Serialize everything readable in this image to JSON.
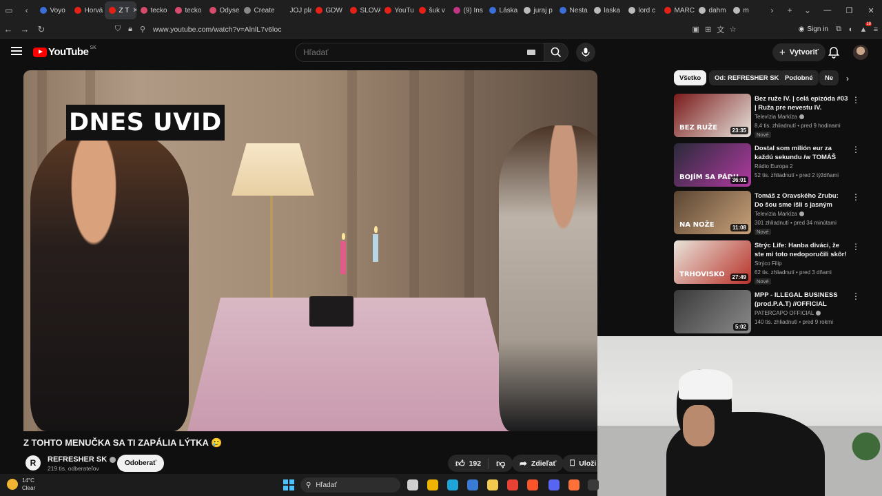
{
  "browser": {
    "tabs": [
      {
        "label": "Voyo",
        "color": "#3b6fd8",
        "active": false
      },
      {
        "label": "Horvá",
        "color": "#e62117",
        "active": false
      },
      {
        "label": "Z T",
        "color": "#e62117",
        "active": true
      },
      {
        "label": "tecko",
        "color": "#d64b6b",
        "active": false
      },
      {
        "label": "tecko",
        "color": "#d64b6b",
        "active": false
      },
      {
        "label": "Odyse",
        "color": "#d64b6b",
        "active": false
      },
      {
        "label": "Create",
        "color": "#888888",
        "active": false
      },
      {
        "label": "JOJ play",
        "color": "#1f1f1f",
        "active": false
      },
      {
        "label": "GDW",
        "color": "#e62117",
        "active": false
      },
      {
        "label": "SLOVA",
        "color": "#e62117",
        "active": false
      },
      {
        "label": "YouTu",
        "color": "#e62117",
        "active": false
      },
      {
        "label": "šuk v",
        "color": "#e62117",
        "active": false
      },
      {
        "label": "(9) Ins",
        "color": "#c13584",
        "active": false
      },
      {
        "label": "Láska",
        "color": "#3b6fd8",
        "active": false
      },
      {
        "label": "juraj p",
        "color": "#bbbbbb",
        "active": false
      },
      {
        "label": "Nesta",
        "color": "#3b6fd8",
        "active": false
      },
      {
        "label": "laska",
        "color": "#bbbbbb",
        "active": false
      },
      {
        "label": "lord c",
        "color": "#bbbbbb",
        "active": false
      },
      {
        "label": "MARC",
        "color": "#e62117",
        "active": false
      },
      {
        "label": "dahm",
        "color": "#bbbbbb",
        "active": false
      },
      {
        "label": "m",
        "color": "#bbbbbb",
        "active": false
      }
    ],
    "url": "www.youtube.com/watch?v=AlnlL7v6loc",
    "signin_label": "Sign in",
    "ext_badge": "18"
  },
  "youtube": {
    "logo_text": "YouTube",
    "country": "SK",
    "search_placeholder": "Hľadať",
    "create_label": "Vytvoriť",
    "chips": [
      "Všetko",
      "Od: REFRESHER SK",
      "Podobné",
      "Ne"
    ]
  },
  "video": {
    "caption_overlay": "DNES UVID",
    "title": "Z TOHTO MENUČKA SA TI ZAPÁLIA LÝTKA 🥲",
    "channel_logo": "R",
    "channel_name": "REFRESHER SK",
    "subscribers": "219 tis. odberateľov",
    "subscribe_label": "Odoberať",
    "likes": "192",
    "share_label": "Zdieľať",
    "save_label": "Uloži"
  },
  "recommendations": [
    {
      "title": "Bez ruže IV. | celá epizóda #03 | Ruža pre nevestu IV.",
      "channel": "Televízia Markíza",
      "verified": true,
      "meta": "8,4 tis. zhliadnutí • pred 9 hodinami",
      "badge": "Nové",
      "duration": "23:35",
      "thumb_text": "BEZ RUŽE",
      "thumb_colors": [
        "#7a1a1a",
        "#e7e3dc"
      ]
    },
    {
      "title": "Dostal som milión eur za každú sekundu /w TOMÁŠ KRIŽAN | ...",
      "channel": "Rádio Europa 2",
      "verified": false,
      "meta": "52 tis. zhliadnutí • pred 2 týždňami",
      "badge": "",
      "duration": "36:01",
      "thumb_text": "BOJÍM SA PÁDU",
      "thumb_colors": [
        "#2a2a3a",
        "#b03aa0"
      ]
    },
    {
      "title": "Tomáš z Oravského Zrubu: Do šou sme išli s jasným cieľom, ...",
      "channel": "Televízia Markíza",
      "verified": true,
      "meta": "301 zhliadnutí • pred 34 minútami",
      "badge": "Nové",
      "duration": "11:08",
      "thumb_text": "NA NOŽE",
      "thumb_colors": [
        "#5a4533",
        "#c9a27a"
      ]
    },
    {
      "title": "Strýc Life: Hanba diváci, že ste mi toto nedoporučili skôr! Toto...",
      "channel": "Strýco Filip",
      "verified": false,
      "meta": "62 tis. zhliadnutí • pred 3 dňami",
      "badge": "Nové",
      "duration": "27:49",
      "thumb_text": "TRHOVISKO",
      "thumb_colors": [
        "#e9e4da",
        "#b8322a"
      ]
    },
    {
      "title": "MPP - ILLEGAL BUSINESS (prod.P.A.T) //OFFICIAL STOK...",
      "channel": "PATERCAPO OFFICIAL",
      "verified": true,
      "meta": "140 tis. zhliadnutí • pred 9 rokmi",
      "badge": "",
      "duration": "5:02",
      "thumb_text": "",
      "thumb_colors": [
        "#3a3a3a",
        "#8a8a8a"
      ]
    }
  ],
  "taskbar": {
    "temperature": "14°C",
    "weather": "Clear",
    "search_label": "Hľadať",
    "apps": [
      {
        "name": "task-view",
        "color": "#cfcfcf"
      },
      {
        "name": "store",
        "color": "#f0b400"
      },
      {
        "name": "edge",
        "color": "#1fa4d8"
      },
      {
        "name": "photos",
        "color": "#3a7bd5"
      },
      {
        "name": "explorer",
        "color": "#f2c94c"
      },
      {
        "name": "chrome",
        "color": "#e94235"
      },
      {
        "name": "brave",
        "color": "#fb542b"
      },
      {
        "name": "discord",
        "color": "#5865f2"
      },
      {
        "name": "firefox",
        "color": "#ff7139"
      },
      {
        "name": "obs",
        "color": "#3a3a3a"
      }
    ]
  }
}
